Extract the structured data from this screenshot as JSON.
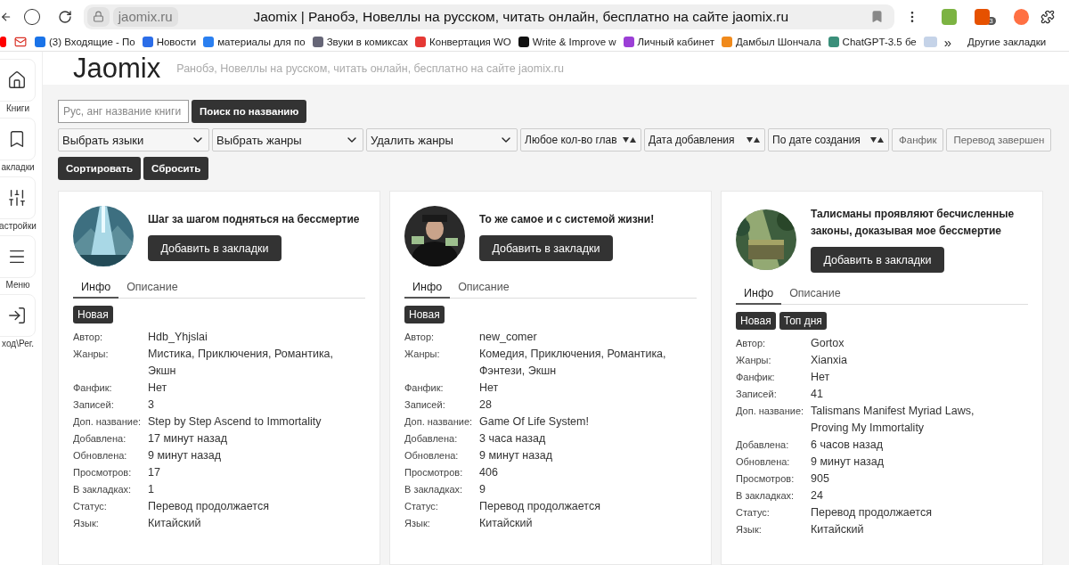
{
  "browser": {
    "url": "jaomix.ru",
    "title": "Jaomix | Ранобэ, Новеллы на русском, читать онлайн, бесплатно на сайте jaomix.ru",
    "badge": "3",
    "bookmarks": [
      {
        "label": "(3) Входящие - По",
        "color": "#1a73e8"
      },
      {
        "label": "Новости",
        "color": "#2b6de8"
      },
      {
        "label": "материалы для по",
        "color": "#2a7ff0"
      },
      {
        "label": "Звуки в комиксах",
        "color": "#666677"
      },
      {
        "label": "Конвертация WO",
        "color": "#e53935"
      },
      {
        "label": "Write & Improve w",
        "color": "#111111"
      },
      {
        "label": "Личный кабинет",
        "color": "#9b3fd6"
      },
      {
        "label": "Дамбыл Шончала",
        "color": "#f08a1c"
      },
      {
        "label": "ChatGPT-3.5 бе",
        "color": "#3a8f7a"
      }
    ],
    "more": "»",
    "other_bookmarks": "Другие закладки"
  },
  "sidebar": [
    {
      "label": "Книги"
    },
    {
      "label": "акладки"
    },
    {
      "label": "астройки"
    },
    {
      "label": "Меню"
    },
    {
      "label": "ход\\Рег."
    }
  ],
  "header": {
    "logo": "Jaomix",
    "tagline": "Ранобэ, Новеллы на русском, читать онлайн, бесплатно на сайте jaomix.ru"
  },
  "search": {
    "placeholder": "Рус, анг название книги",
    "button": "Поиск по названию"
  },
  "filters": [
    {
      "kind": "select",
      "label": "Выбрать языки"
    },
    {
      "kind": "select",
      "label": "Выбрать жанры"
    },
    {
      "kind": "select",
      "label": "Удалить жанры"
    },
    {
      "kind": "sort",
      "label": "Любое кол-во глав"
    },
    {
      "kind": "sort",
      "label": "Дата добавления"
    },
    {
      "kind": "sort",
      "label": "По дате создания"
    },
    {
      "kind": "toggle",
      "label": "Фанфик"
    },
    {
      "kind": "toggle",
      "label": "Перевод завершен"
    }
  ],
  "actions": [
    "Сортировать",
    "Сбросить"
  ],
  "cards": [
    {
      "title": "Шаг за шагом подняться на бессмертие",
      "button": "Добавить в закладки",
      "tabs": [
        {
          "label": "Инфо",
          "selected": true
        },
        {
          "label": "Описание",
          "selected": false
        }
      ],
      "badges": [
        "Новая"
      ],
      "fields": [
        {
          "label": "Автор:",
          "value": "Hdb_Yhjslai"
        },
        {
          "label": "Жанры:",
          "value": "Мистика, Приключения, Романтика, Экшн"
        },
        {
          "label": "Фанфик:",
          "value": "Нет"
        },
        {
          "label": "Записей:",
          "value": "3"
        },
        {
          "label": "Доп. название:",
          "value": "Step by Step Ascend to Immortality"
        },
        {
          "label": "Добавлена:",
          "value": "17 минут назад"
        },
        {
          "label": "Обновлена:",
          "value": "9 минут назад"
        },
        {
          "label": "Просмотров:",
          "value": "17"
        },
        {
          "label": "В закладках:",
          "value": "1"
        },
        {
          "label": "Статус:",
          "value": "Перевод продолжается"
        },
        {
          "label": "Язык:",
          "value": "Китайский"
        }
      ]
    },
    {
      "title": "То же самое и с системой жизни!",
      "button": "Добавить в закладки",
      "tabs": [
        {
          "label": "Инфо",
          "selected": true
        },
        {
          "label": "Описание",
          "selected": false
        }
      ],
      "badges": [
        "Новая"
      ],
      "fields": [
        {
          "label": "Автор:",
          "value": "new_comer"
        },
        {
          "label": "Жанры:",
          "value": "Комедия, Приключения, Романтика, Фэнтези, Экшн"
        },
        {
          "label": "Фанфик:",
          "value": "Нет"
        },
        {
          "label": "Записей:",
          "value": "28"
        },
        {
          "label": "Доп. название:",
          "value": "Game Of Life System!"
        },
        {
          "label": "Добавлена:",
          "value": "3 часа назад"
        },
        {
          "label": "Обновлена:",
          "value": "9 минут назад"
        },
        {
          "label": "Просмотров:",
          "value": "406"
        },
        {
          "label": "В закладках:",
          "value": "9"
        },
        {
          "label": "Статус:",
          "value": "Перевод продолжается"
        },
        {
          "label": "Язык:",
          "value": "Китайский"
        }
      ]
    },
    {
      "title": "Талисманы проявляют бесчисленные законы, доказывая мое бессмертие",
      "button": "Добавить в закладки",
      "tabs": [
        {
          "label": "Инфо",
          "selected": true
        },
        {
          "label": "Описание",
          "selected": false
        }
      ],
      "badges": [
        "Новая",
        "Топ дня"
      ],
      "fields": [
        {
          "label": "Автор:",
          "value": "Gortox"
        },
        {
          "label": "Жанры:",
          "value": "Xianxia"
        },
        {
          "label": "Фанфик:",
          "value": "Нет"
        },
        {
          "label": "Записей:",
          "value": "41"
        },
        {
          "label": "Доп. название:",
          "value": "Talismans Manifest Myriad Laws, Proving My Immortality"
        },
        {
          "label": "Добавлена:",
          "value": "6 часов назад"
        },
        {
          "label": "Обновлена:",
          "value": "9 минут назад"
        },
        {
          "label": "Просмотров:",
          "value": "905"
        },
        {
          "label": "В закладках:",
          "value": "24"
        },
        {
          "label": "Статус:",
          "value": "Перевод продолжается"
        },
        {
          "label": "Язык:",
          "value": "Китайский"
        }
      ]
    }
  ]
}
